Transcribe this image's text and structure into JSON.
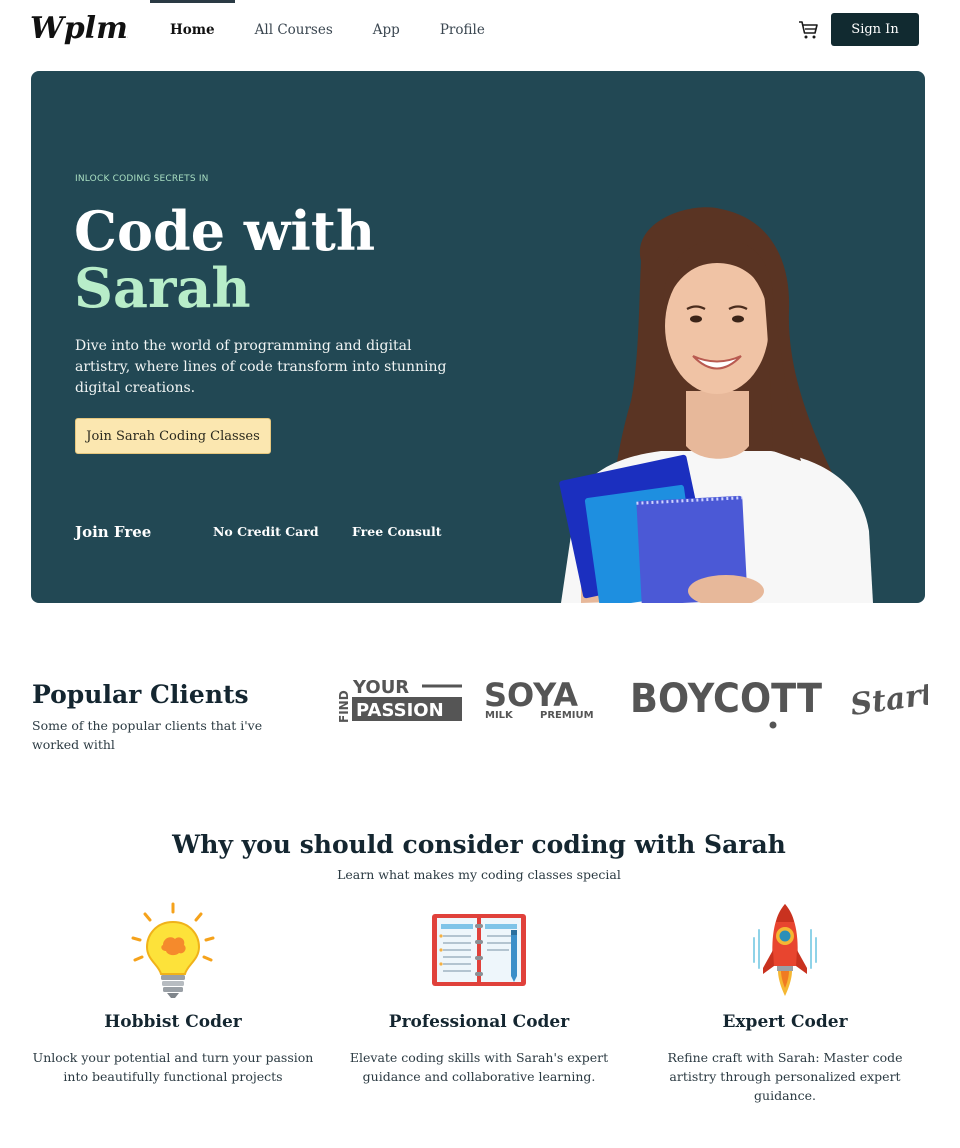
{
  "brand": {
    "logo_text": "Wplms"
  },
  "nav": {
    "items": [
      {
        "label": "Home",
        "active": true
      },
      {
        "label": "All Courses",
        "active": false
      },
      {
        "label": "App",
        "active": false
      },
      {
        "label": "Profile",
        "active": false
      }
    ],
    "cart_icon": "cart-icon",
    "signin_label": "Sign In"
  },
  "hero": {
    "eyebrow": "INLOCK CODING SECRETS IN",
    "title_line1": "Code with",
    "title_line2": "Sarah",
    "description": "Dive into the world of programming and digital artistry, where lines of code transform into stunning digital creations.",
    "cta_label": "Join Sarah Coding Classes",
    "perks": [
      "Join Free",
      "No Credit Card",
      "Free Consult"
    ]
  },
  "clients": {
    "title": "Popular Clients",
    "subtitle": "Some of the popular clients that i've worked withl",
    "logos": [
      {
        "lines": [
          "FIND",
          "YOUR",
          "PASSION"
        ]
      },
      {
        "lines": [
          "SOYA",
          "MILK",
          "PREMIUM"
        ]
      },
      {
        "lines": [
          "BOYCOTT"
        ]
      },
      {
        "lines": [
          "Start"
        ]
      }
    ]
  },
  "why": {
    "title": "Why you should consider coding with Sarah",
    "subtitle": "Learn what makes my coding classes special",
    "features": [
      {
        "icon": "lightbulb-icon",
        "title": "Hobbist Coder",
        "description": "Unlock your potential and turn your passion into beautifully functional projects"
      },
      {
        "icon": "notebook-icon",
        "title": "Professional Coder",
        "description": "Elevate coding skills with Sarah's expert guidance and collaborative learning."
      },
      {
        "icon": "rocket-icon",
        "title": "Expert Coder",
        "description": "Refine craft with Sarah: Master code artistry through personalized expert guidance."
      }
    ]
  },
  "colors": {
    "hero_bg": "#224854",
    "accent_green": "#b8edc9",
    "cta_bg": "#fbe7b0",
    "signin_bg": "#112a30"
  }
}
